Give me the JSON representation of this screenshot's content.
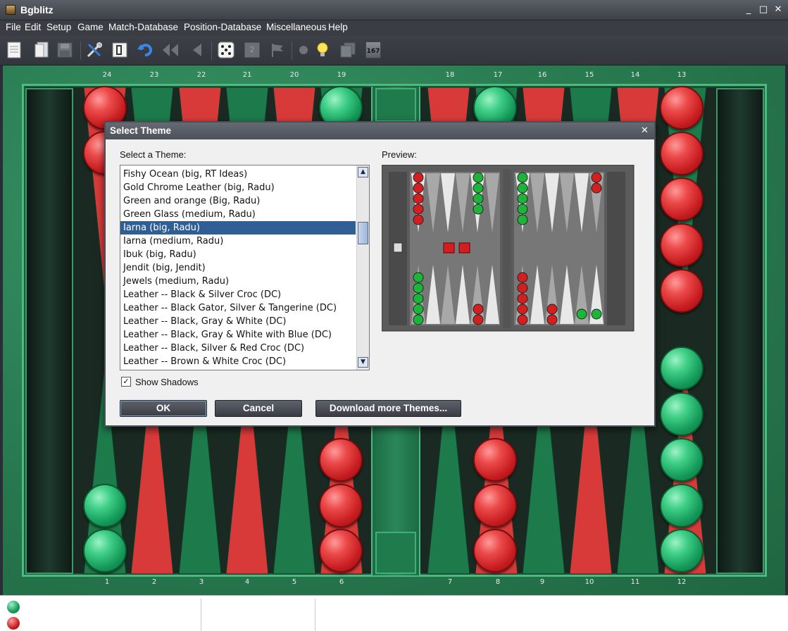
{
  "window": {
    "title": "Bgblitz",
    "minimize": "_",
    "maximize": "□",
    "close": "✕"
  },
  "menu": [
    "File",
    "Edit",
    "Setup",
    "Game",
    "Match-Database",
    "Position-Database",
    "Miscellaneous",
    "Help"
  ],
  "toolbar": {
    "icons": [
      "new-document-icon",
      "open-icon",
      "save-icon",
      "settings-tools-icon",
      "edit-position-icon",
      "undo-icon",
      "rewind-icon",
      "back-icon",
      "dice-icon",
      "double-cube-icon",
      "resign-flag-icon",
      "record-icon",
      "hint-bulb-icon",
      "copy-icon",
      "pip-count-icon"
    ],
    "cube_label": "2",
    "pip_label": "167"
  },
  "board": {
    "top_points": [
      "24",
      "23",
      "22",
      "21",
      "20",
      "19",
      "18",
      "17",
      "16",
      "15",
      "14",
      "13"
    ],
    "bottom_points": [
      "1",
      "2",
      "3",
      "4",
      "5",
      "6",
      "7",
      "8",
      "9",
      "10",
      "11",
      "12"
    ]
  },
  "dialog": {
    "title": "Select Theme",
    "close": "✕",
    "list_label": "Select a Theme:",
    "preview_label": "Preview:",
    "themes": [
      "Fishy Ocean (big, RT Ideas)",
      "Gold Chrome Leather (big, Radu)",
      "Green and orange (Big, Radu)",
      "Green Glass (medium, Radu)",
      "Iarna (big, Radu)",
      "Iarna (medium, Radu)",
      "Ibuk (big, Radu)",
      "Jendit  (big, Jendit)",
      "Jewels (medium, Radu)",
      "Leather -- Black & Silver Croc (DC)",
      "Leather -- Black Gator, Silver & Tangerine (DC)",
      "Leather -- Black, Gray & White (DC)",
      "Leather -- Black, Gray & White with Blue (DC)",
      "Leather -- Black, Silver & Red Croc (DC)",
      "Leather -- Brown & White Croc (DC)"
    ],
    "selected_index": 4,
    "show_shadows_label": "Show Shadows",
    "show_shadows_checked": true,
    "checkbox_mark": "✓",
    "scroll_up": "▲",
    "scroll_down": "▼",
    "ok_label": "OK",
    "cancel_label": "Cancel",
    "download_label": "Download more Themes..."
  },
  "colors": {
    "board_green": "#2a7d52",
    "point_red": "#d83a3a",
    "checker_red": "#c81e22",
    "checker_green": "#159a5a",
    "selection": "#2f5f94"
  }
}
